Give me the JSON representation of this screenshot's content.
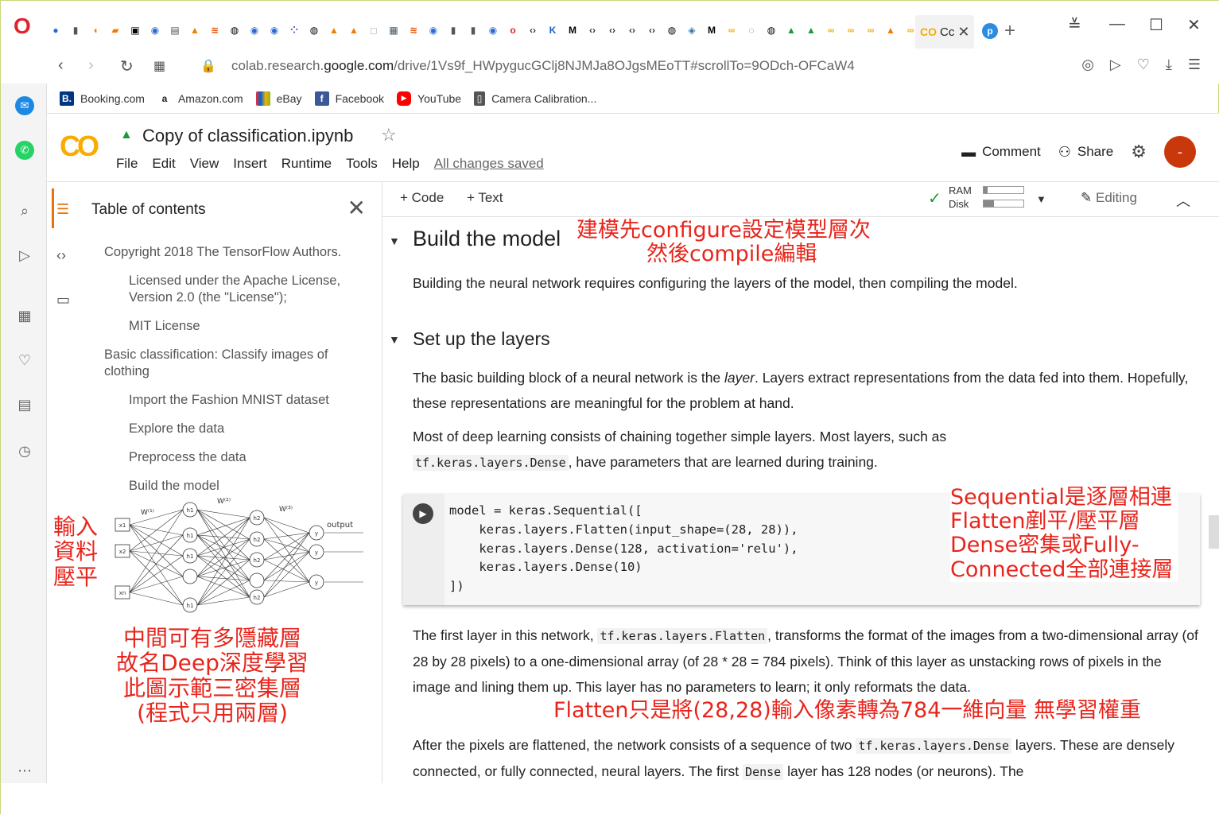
{
  "browser": {
    "url_prefix": "colab.research.",
    "url_domain": "google.com",
    "url_path": "/drive/1Vs9f_HWpygucGClj8NJMJa8OJgsMEoTT#scrollTo=9ODch-OFCaW4",
    "active_tab_label": "Cc",
    "bookmarks": [
      {
        "label": "Booking.com",
        "icon": "B.",
        "color": "#003580"
      },
      {
        "label": "Amazon.com",
        "icon": "a",
        "color": "#222222"
      },
      {
        "label": "eBay",
        "icon": "",
        "color": "#e53238"
      },
      {
        "label": "Facebook",
        "icon": "f",
        "color": "#3b5998"
      },
      {
        "label": "YouTube",
        "icon": "▶",
        "color": "#ff0000"
      },
      {
        "label": "Camera Calibration...",
        "icon": "",
        "color": "#555555"
      }
    ]
  },
  "colab": {
    "logo": "CO",
    "doc_title": "Copy of classification.ipynb",
    "menus": [
      "File",
      "Edit",
      "View",
      "Insert",
      "Runtime",
      "Tools",
      "Help"
    ],
    "saved_status": "All changes saved",
    "comment_label": "Comment",
    "share_label": "Share",
    "avatar": "-"
  },
  "toc": {
    "title": "Table of contents",
    "items": [
      {
        "label": "Copyright 2018 The TensorFlow Authors."
      },
      {
        "label": "Licensed under the Apache License, Version 2.0 (the \"License\");"
      },
      {
        "label": "MIT License"
      },
      {
        "label": "Basic classification: Classify images of clothing"
      },
      {
        "label": "Import the Fashion MNIST dataset"
      },
      {
        "label": "Explore the data"
      },
      {
        "label": "Preprocess the data"
      },
      {
        "label": "Build the model"
      }
    ]
  },
  "toolbar": {
    "code_label": "+ Code",
    "text_label": "+ Text",
    "ram_label": "RAM",
    "disk_label": "Disk",
    "editing_label": "Editing"
  },
  "notebook": {
    "h1": "Build the model",
    "p1": "Building the neural network requires configuring the layers of the model, then compiling the model.",
    "h2": "Set up the layers",
    "p2a": "The basic building block of a neural network is the ",
    "p2_em": "layer",
    "p2b": ". Layers extract representations from the data fed into them. Hopefully, these representations are meaningful for the problem at hand.",
    "p3a": "Most of deep learning consists of chaining together simple layers. Most layers, such as",
    "p3_code": "tf.keras.layers.Dense",
    "p3b": ", have parameters that are learned during training.",
    "code_lines": [
      "model = keras.Sequential([",
      "    keras.layers.Flatten(input_shape=(28, 28)),",
      "    keras.layers.Dense(128, activation='relu'),",
      "    keras.layers.Dense(10)",
      "])"
    ],
    "p4a": "The first layer in this network, ",
    "p4_code": "tf.keras.layers.Flatten",
    "p4b": ", transforms the format of the images from a two-dimensional array (of 28 by 28 pixels) to a one-dimensional array (of 28 * 28 = 784 pixels). Think of this layer as unstacking rows of pixels in the image and lining them up. This layer has no parameters to learn; it only reformats the data.",
    "p5a": "After the pixels are flattened, the network consists of a sequence of two ",
    "p5_code": "tf.keras.layers.Dense",
    "p5b": " layers. These are densely connected, or fully connected, neural layers. The first ",
    "p5_code2": "Dense",
    "p5c": " layer has 128 nodes (or neurons). The"
  },
  "diagram": {
    "w1": "W⁽¹⁾",
    "w2": "W⁽²⁾",
    "w3": "W⁽³⁾",
    "output": "output",
    "x1": "x1",
    "x2": "x2",
    "xn": "xn",
    "h1": "h1",
    "h2": "h2",
    "y": "y"
  },
  "annotations": {
    "a1_line1": "建模先configure設定模型層次",
    "a1_line2": "然後compile編輯",
    "a2_line1": "Sequential是逐層相連",
    "a2_line2": "Flatten剷平/壓平層",
    "a2_line3": "Dense密集或Fully-",
    "a2_line4": "Connected全部連接層",
    "a3_line1": "輸入",
    "a3_line2": "資料",
    "a3_line3": "壓平",
    "a4_line1": "中間可有多隱藏層",
    "a4_line2": "故名Deep深度學習",
    "a4_line3": "此圖示範三密集層",
    "a4_line4": "(程式只用兩層)",
    "a5": "Flatten只是將(28,28)輸入像素轉為784一維向量 無學習權重"
  },
  "colors": {
    "accent": "#e8710a",
    "annotation": "#e8251c",
    "avatar": "#c8380b",
    "colab_logo": "#f9ab00"
  }
}
